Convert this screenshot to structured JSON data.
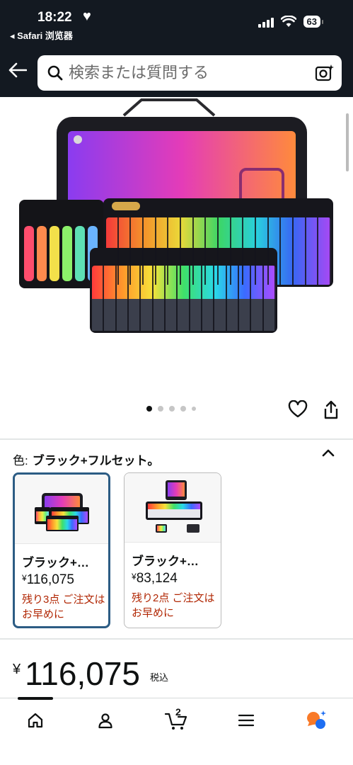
{
  "status_bar": {
    "time": "18:22",
    "back_app": "◂ Safari 浏览器",
    "battery": "63"
  },
  "search": {
    "placeholder": "検索または質問する"
  },
  "gallery": {
    "dot_count": 5,
    "active_index": 0
  },
  "variant_section": {
    "label": "色:",
    "selected_value": "ブラック+フルセット。",
    "options": [
      {
        "name": "ブラック+…",
        "yen": "¥",
        "price": "116,075",
        "stock": "残り3点 ご注文はお早めに",
        "selected": true
      },
      {
        "name": "ブラック+…",
        "yen": "¥",
        "price": "83,124",
        "stock": "残り2点 ご注文はお早めに",
        "selected": false
      }
    ]
  },
  "price": {
    "currency": "¥",
    "amount": "116,075",
    "tax_note": "税込"
  },
  "bottom_nav": {
    "cart_count": "2"
  },
  "colors": {
    "header_bg": "#131921",
    "selected_border": "#2c5c84",
    "stock_red": "#b12704",
    "assistant_orange": "#f97a28",
    "assistant_blue": "#1e6ef2"
  }
}
